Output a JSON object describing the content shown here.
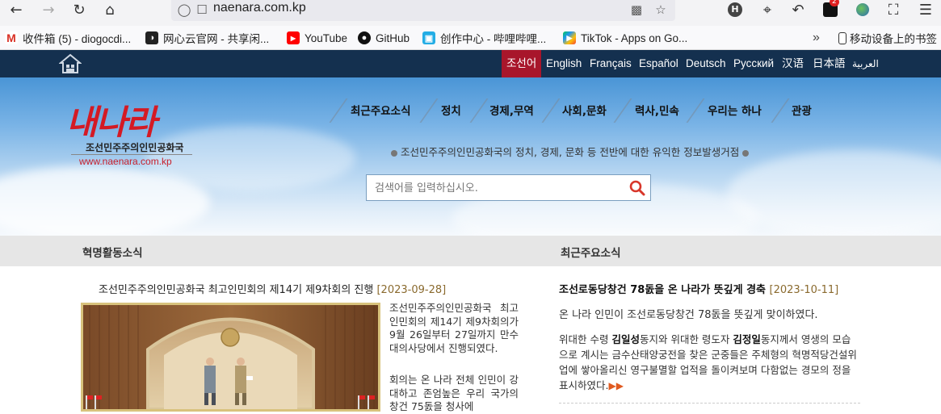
{
  "browser": {
    "url": "naenara.com.kp",
    "bookmarks": [
      {
        "label": "收件箱 (5) - diogocdi...",
        "icon": "gmail-icon",
        "color": "#d93025"
      },
      {
        "label": "网心云官网 - 共享闲...",
        "icon": "wangxinyun-icon",
        "color": "#222222"
      },
      {
        "label": "YouTube",
        "icon": "youtube-icon",
        "color": "#ff0000"
      },
      {
        "label": "GitHub",
        "icon": "github-icon",
        "color": "#111111"
      },
      {
        "label": "创作中心 - 哔哩哔哩...",
        "icon": "bilibili-icon",
        "color": "#23ade5"
      },
      {
        "label": "TikTok - Apps on Go...",
        "icon": "google-play-icon",
        "color": "#01875f"
      }
    ],
    "mobile_bookmarks": "移动设备上的书签",
    "badge_count": "2"
  },
  "site": {
    "languages": [
      {
        "label": "조선어",
        "active": true
      },
      {
        "label": "English"
      },
      {
        "label": "Français"
      },
      {
        "label": "Español"
      },
      {
        "label": "Deutsch"
      },
      {
        "label": "Русский"
      },
      {
        "label": "汉语"
      },
      {
        "label": "日本語"
      },
      {
        "label": "العربية"
      }
    ],
    "logo": {
      "title": "내나라",
      "subtitle": "조선민주주의인민공화국",
      "url": "www.naenara.com.kp"
    },
    "nav": [
      "최근주요소식",
      "정치",
      "경제,무역",
      "사회,문화",
      "력사,민속",
      "우리는 하나",
      "관광"
    ],
    "tagline": "조선민주주의인민공화국의 정치, 경제, 문화 등 전반에 대한 유익한 정보발생거점",
    "search_placeholder": "검색어를 입력하십시오.",
    "sections": {
      "left_title": "혁명활동소식",
      "right_title": "최근주요소식"
    },
    "left_article": {
      "headline": "조선민주주의인민공화국 최고인민회의 제14기 제9차회의 진행",
      "date": "[2023-09-28]",
      "para1": "조선민주주의인민공화국 최고인민회의 제14기 제9차회의가 9월 26일부터 27일까지 만수대의사당에서 진행되였다.",
      "para2": "회의는 온 나라 전체 인민이 강대하고 존엄높은 우리 국가의 창건 75돐을 청사에"
    },
    "right_article": {
      "headline": "조선로동당창건 78돐을 온 나라가 뜻깊게 경축",
      "date": "[2023-10-11]",
      "p1": "온 나라 인민이 조선로동당창건 78돐을 뜻깊게 맞이하였다.",
      "p2_a": "위대한 수령 ",
      "p2_name1": "김일성",
      "p2_b": "동지와 위대한 령도자 ",
      "p2_name2": "김정일",
      "p2_c": "동지께서 영생의 모습으로 계시는 금수산태양궁전을 찾은 군중들은 주체형의 혁명적당건설위업에 쌓아올리신 영구불멸할 업적을 돌이켜보며 다함없는 경모의 정을 표시하였다."
    }
  }
}
